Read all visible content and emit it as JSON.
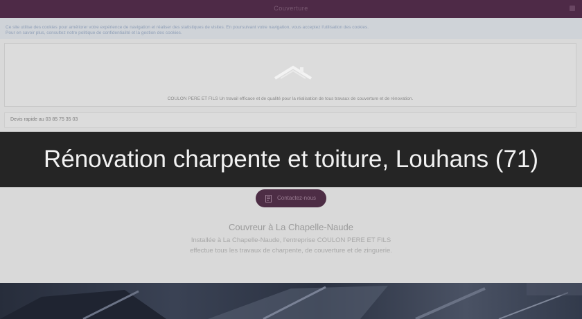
{
  "topbar": {
    "center_text": "Couverture",
    "icon": "menu-icon"
  },
  "notice": {
    "line1": "Ce site utilise des cookies pour améliorer votre expérience de navigation et réaliser des statistiques de visites. En poursuivant votre navigation, vous acceptez l'utilisation des cookies.",
    "line2": "Pour en savoir plus, consultez notre politique de confidentialité et la gestion des cookies."
  },
  "hero": {
    "logo_icon": "roof-logo-icon",
    "tagline": "COULON PERE ET FILS Un travail efficace et de qualité pour la réalisation de tous travaux de couverture et de rénovation."
  },
  "quote": {
    "text": "Devis rapide au 03 85 75 35 03"
  },
  "overlay": {
    "title": "Rénovation charpente et toiture, Louhans (71)"
  },
  "contact": {
    "label": "Contactez-nous",
    "icon": "contact-form-icon"
  },
  "section": {
    "title": "Couvreur à La Chapelle-Naude",
    "body": "Installée à La Chapelle-Naude, l'entreprise COULON PERE ET FILS effectue tous les travaux de charpente, de couverture et de zinguerie."
  },
  "colors": {
    "brand": "#4e2a47",
    "overlay": "#252525"
  }
}
